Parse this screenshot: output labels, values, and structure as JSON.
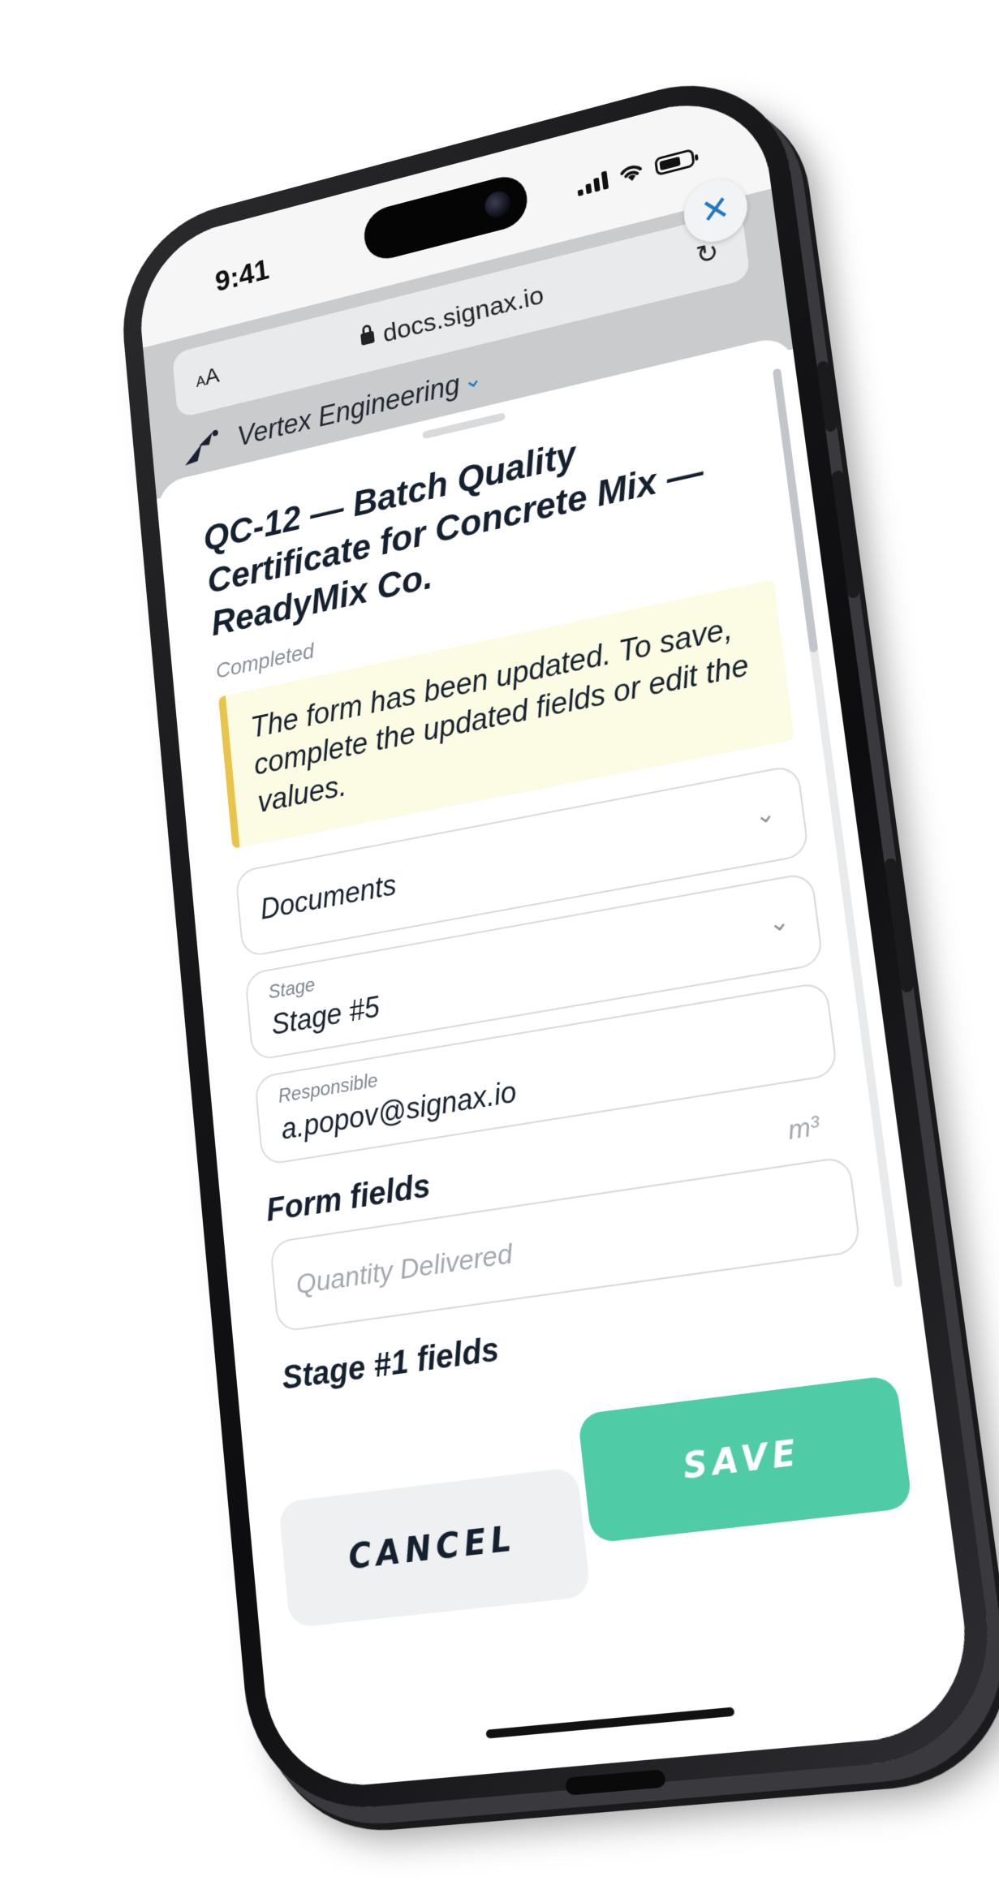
{
  "status_bar": {
    "time": "9:41"
  },
  "browser": {
    "text_size_label_small": "A",
    "text_size_label_large": "A",
    "url": "docs.signax.io",
    "reload_icon": "reload-icon",
    "lock_icon": "lock-icon"
  },
  "brand": {
    "name": "Vertex Engineering",
    "logo_icon": "bird-logo-icon",
    "dropdown_icon": "chevron-down-icon",
    "accent_color": "#1d78c1"
  },
  "close_button": {
    "glyph": "✕"
  },
  "form": {
    "title": "QC-12 — Batch Quality Certificate for Concrete Mix — ReadyMix Co.",
    "status": "Completed",
    "notice": "The form has been updated. To save, complete the updated fields or edit the values.",
    "documents": {
      "value": "Documents"
    },
    "stage": {
      "label": "Stage",
      "value": "Stage #5"
    },
    "responsible": {
      "label": "Responsible",
      "value": "a.popov@signax.io"
    },
    "form_fields_title": "Form fields",
    "quantity": {
      "placeholder": "Quantity Delivered",
      "unit": "m³"
    },
    "stage1_title": "Stage #1 fields"
  },
  "actions": {
    "cancel_label": "CANCEL",
    "save_label": "SAVE",
    "save_color": "#4fcba5"
  }
}
